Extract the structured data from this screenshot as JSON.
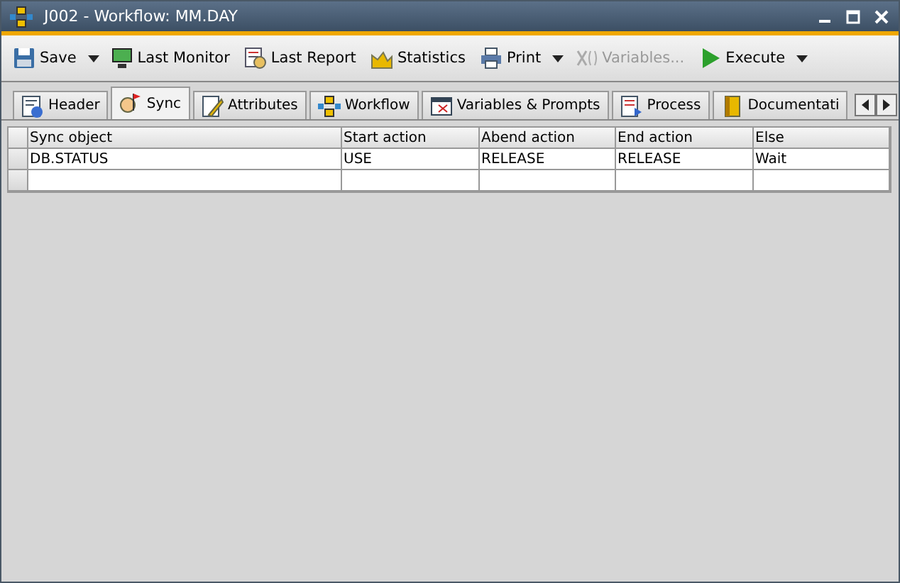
{
  "window": {
    "title": "J002 - Workflow: MM.DAY"
  },
  "toolbar": [
    {
      "label": "Save",
      "dropdown": true,
      "disabled": false
    },
    {
      "label": "Last Monitor",
      "dropdown": false,
      "disabled": false
    },
    {
      "label": "Last Report",
      "dropdown": false,
      "disabled": false
    },
    {
      "label": "Statistics",
      "dropdown": false,
      "disabled": false
    },
    {
      "label": "Print",
      "dropdown": true,
      "disabled": false
    },
    {
      "label": "Variables...",
      "dropdown": false,
      "disabled": true
    },
    {
      "label": "Execute",
      "dropdown": true,
      "disabled": false
    }
  ],
  "tabs": [
    {
      "label": "Header",
      "selected": false
    },
    {
      "label": "Sync",
      "selected": true
    },
    {
      "label": "Attributes",
      "selected": false
    },
    {
      "label": "Workflow",
      "selected": false
    },
    {
      "label": "Variables & Prompts",
      "selected": false
    },
    {
      "label": "Process",
      "selected": false
    },
    {
      "label": "Documentati",
      "selected": false
    }
  ],
  "table": {
    "columns": [
      "Sync object",
      "Start action",
      "Abend action",
      "End action",
      "Else"
    ],
    "rows": [
      [
        "DB.STATUS",
        "USE",
        "RELEASE",
        "RELEASE",
        "Wait"
      ],
      [
        "",
        "",
        "",
        "",
        ""
      ]
    ]
  }
}
